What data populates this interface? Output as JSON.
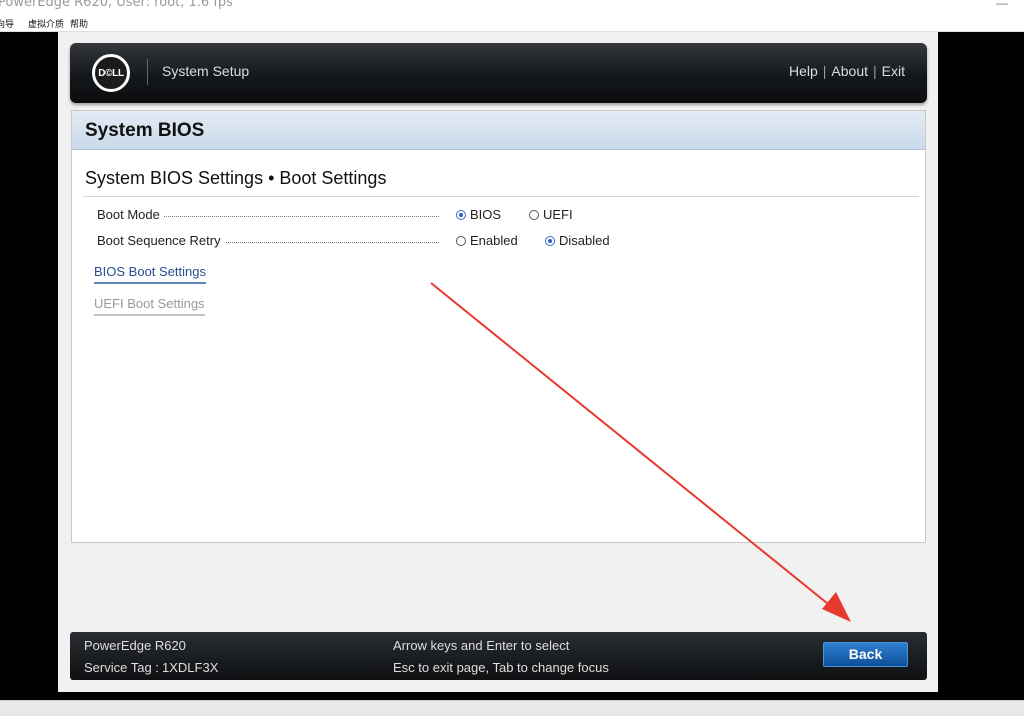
{
  "window": {
    "title": "PowerEdge R620, User: root, 1.6 fps",
    "menu": [
      "向导",
      "虚拟介质",
      "帮助"
    ]
  },
  "header": {
    "logo_text": "D©LL",
    "app_title": "System Setup",
    "links": {
      "help": "Help",
      "sep": "|",
      "about": "About",
      "exit": "Exit"
    }
  },
  "panel": {
    "heading": "System BIOS",
    "page_title": "System BIOS Settings • Boot Settings",
    "settings": [
      {
        "label": "Boot Mode",
        "options": [
          "BIOS",
          "UEFI"
        ],
        "selected": "BIOS"
      },
      {
        "label": "Boot Sequence Retry",
        "options": [
          "Enabled",
          "Disabled"
        ],
        "selected": "Disabled"
      }
    ],
    "links": [
      "BIOS Boot Settings",
      "UEFI Boot Settings"
    ]
  },
  "footer": {
    "model": "PowerEdge R620",
    "service_tag_label": "Service Tag :",
    "service_tag": "1XDLF3X",
    "hint1": "Arrow keys and Enter to select",
    "hint2": "Esc to exit page, Tab to change focus",
    "back_label": "Back"
  },
  "colors": {
    "accent_blue": "#1f63b4",
    "annotation_arrow": "#e8392f",
    "radio_selected": "#2c62c9"
  }
}
